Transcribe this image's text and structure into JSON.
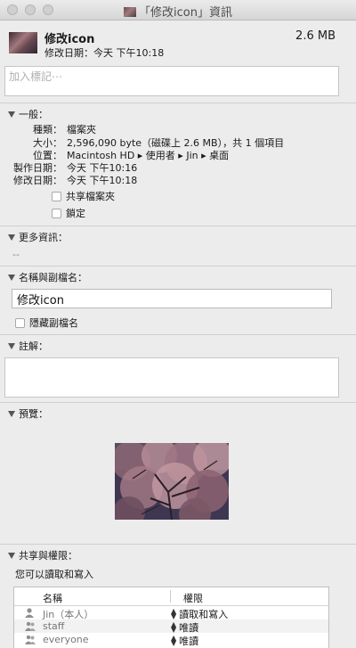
{
  "window": {
    "title": "「修改icon」資訊"
  },
  "header": {
    "name": "修改icon",
    "size": "2.6 MB",
    "modified": "修改日期：今天 下午10:18"
  },
  "tags": {
    "placeholder": "加入標記⋯"
  },
  "general": {
    "label": "一般：",
    "rows": [
      {
        "key": "種類：",
        "value": "檔案夾"
      },
      {
        "key": "大小：",
        "value": "2,596,090 byte（磁碟上 2.6 MB），共 1 個項目"
      },
      {
        "key": "位置：",
        "value": "Macintosh HD ▸ 使用者 ▸ Jin ▸ 桌面"
      },
      {
        "key": "製作日期：",
        "value": "今天 下午10:16"
      },
      {
        "key": "修改日期：",
        "value": "今天 下午10:18"
      }
    ],
    "shared_folder": "共享檔案夾",
    "locked": "鎖定"
  },
  "more_info": {
    "label": "更多資訊：",
    "value": "--"
  },
  "name_ext": {
    "label": "名稱與副檔名：",
    "value": "修改icon",
    "hide_ext": "隱藏副檔名"
  },
  "comments": {
    "label": "註解："
  },
  "preview": {
    "label": "預覽："
  },
  "sharing": {
    "label": "共享與權限：",
    "subtitle": "您可以讀取和寫入",
    "col_name": "名稱",
    "col_priv": "權限",
    "rows": [
      {
        "name": "Jin（本人）",
        "priv": "讀取和寫入",
        "icon": "user-icon"
      },
      {
        "name": "staff",
        "priv": "唯讀",
        "icon": "group-icon"
      },
      {
        "name": "everyone",
        "priv": "唯讀",
        "icon": "group-icon"
      }
    ]
  }
}
